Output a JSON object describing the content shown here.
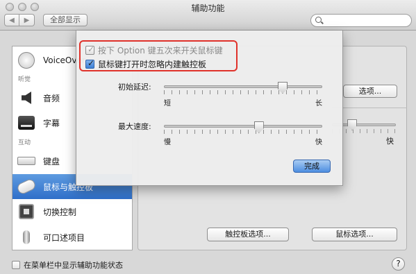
{
  "window": {
    "title": "辅助功能"
  },
  "toolbar": {
    "back": "◀",
    "forward": "▶",
    "show_all": "全部显示",
    "search_placeholder": ""
  },
  "sidebar": {
    "items": [
      {
        "label": "VoiceOver"
      },
      {
        "label": "音频"
      },
      {
        "label": "字幕"
      },
      {
        "label": "键盘"
      },
      {
        "label": "鼠标与触控板"
      },
      {
        "label": "切换控制"
      },
      {
        "label": "可口述项目"
      }
    ],
    "sections": {
      "hearing": "听觉",
      "interaction": "互动"
    }
  },
  "main": {
    "options_button": "选项...",
    "fast_label": "快",
    "trackpad_options_button": "触控板选项...",
    "mouse_options_button": "鼠标选项..."
  },
  "sheet": {
    "option_toggle_label": "按下 Option 键五次来开关鼠标键",
    "option_toggle_checked": true,
    "ignore_trackpad_label": "鼠标键打开时忽略内建触控板",
    "ignore_trackpad_checked": true,
    "initial_delay_label": "初始延迟:",
    "initial_delay": {
      "value": 0.75,
      "min_label": "短",
      "max_label": "长"
    },
    "max_speed_label": "最大速度:",
    "max_speed": {
      "value": 0.6,
      "min_label": "慢",
      "max_label": "快"
    },
    "done_button": "完成"
  },
  "footer": {
    "menu_bar_status_label": "在菜单栏中显示辅助功能状态",
    "help": "?"
  },
  "colors": {
    "selection": "#3a78d1",
    "highlight": "#e0312a",
    "default_button": "#4d8ee0"
  }
}
